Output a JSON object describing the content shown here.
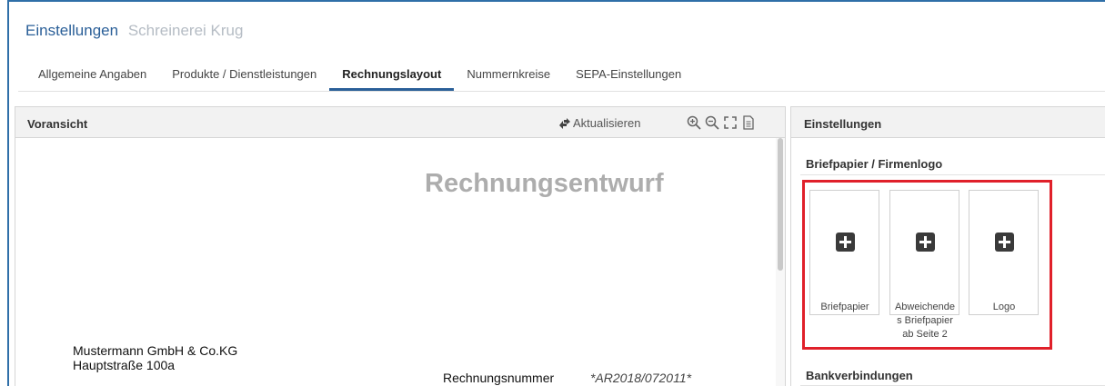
{
  "header": {
    "title": "Einstellungen",
    "company": "Schreinerei Krug"
  },
  "tabs": [
    {
      "label": "Allgemeine Angaben",
      "active": false
    },
    {
      "label": "Produkte / Dienstleistungen",
      "active": false
    },
    {
      "label": "Rechnungslayout",
      "active": true
    },
    {
      "label": "Nummernkreise",
      "active": false
    },
    {
      "label": "SEPA-Einstellungen",
      "active": false
    }
  ],
  "preview": {
    "title": "Voransicht",
    "refresh_label": "Aktualisieren",
    "tools": [
      "zoom-in-icon",
      "zoom-out-icon",
      "fullscreen-icon",
      "document-icon"
    ],
    "doc": {
      "heading": "Rechnungsentwurf",
      "address_line1": "Mustermann GmbH & Co.KG",
      "address_line2": "Hauptstraße 100a",
      "invoice_number_label": "Rechnungsnummer",
      "invoice_number_value": "*AR2018/072011*"
    }
  },
  "settings": {
    "title": "Einstellungen",
    "letterhead_section": "Briefpapier / Firmenlogo",
    "uploads": [
      {
        "label": "Briefpapier"
      },
      {
        "label": "Abweichende s Briefpapier ab Seite 2",
        "lines": [
          "Abweichende",
          "s Briefpapier",
          "ab Seite 2"
        ]
      },
      {
        "label": "Logo"
      }
    ],
    "bank_section": "Bankverbindungen"
  },
  "colors": {
    "accent": "#2a5f98",
    "highlight": "#e0202a",
    "panel_header": "#f2f2f2"
  }
}
